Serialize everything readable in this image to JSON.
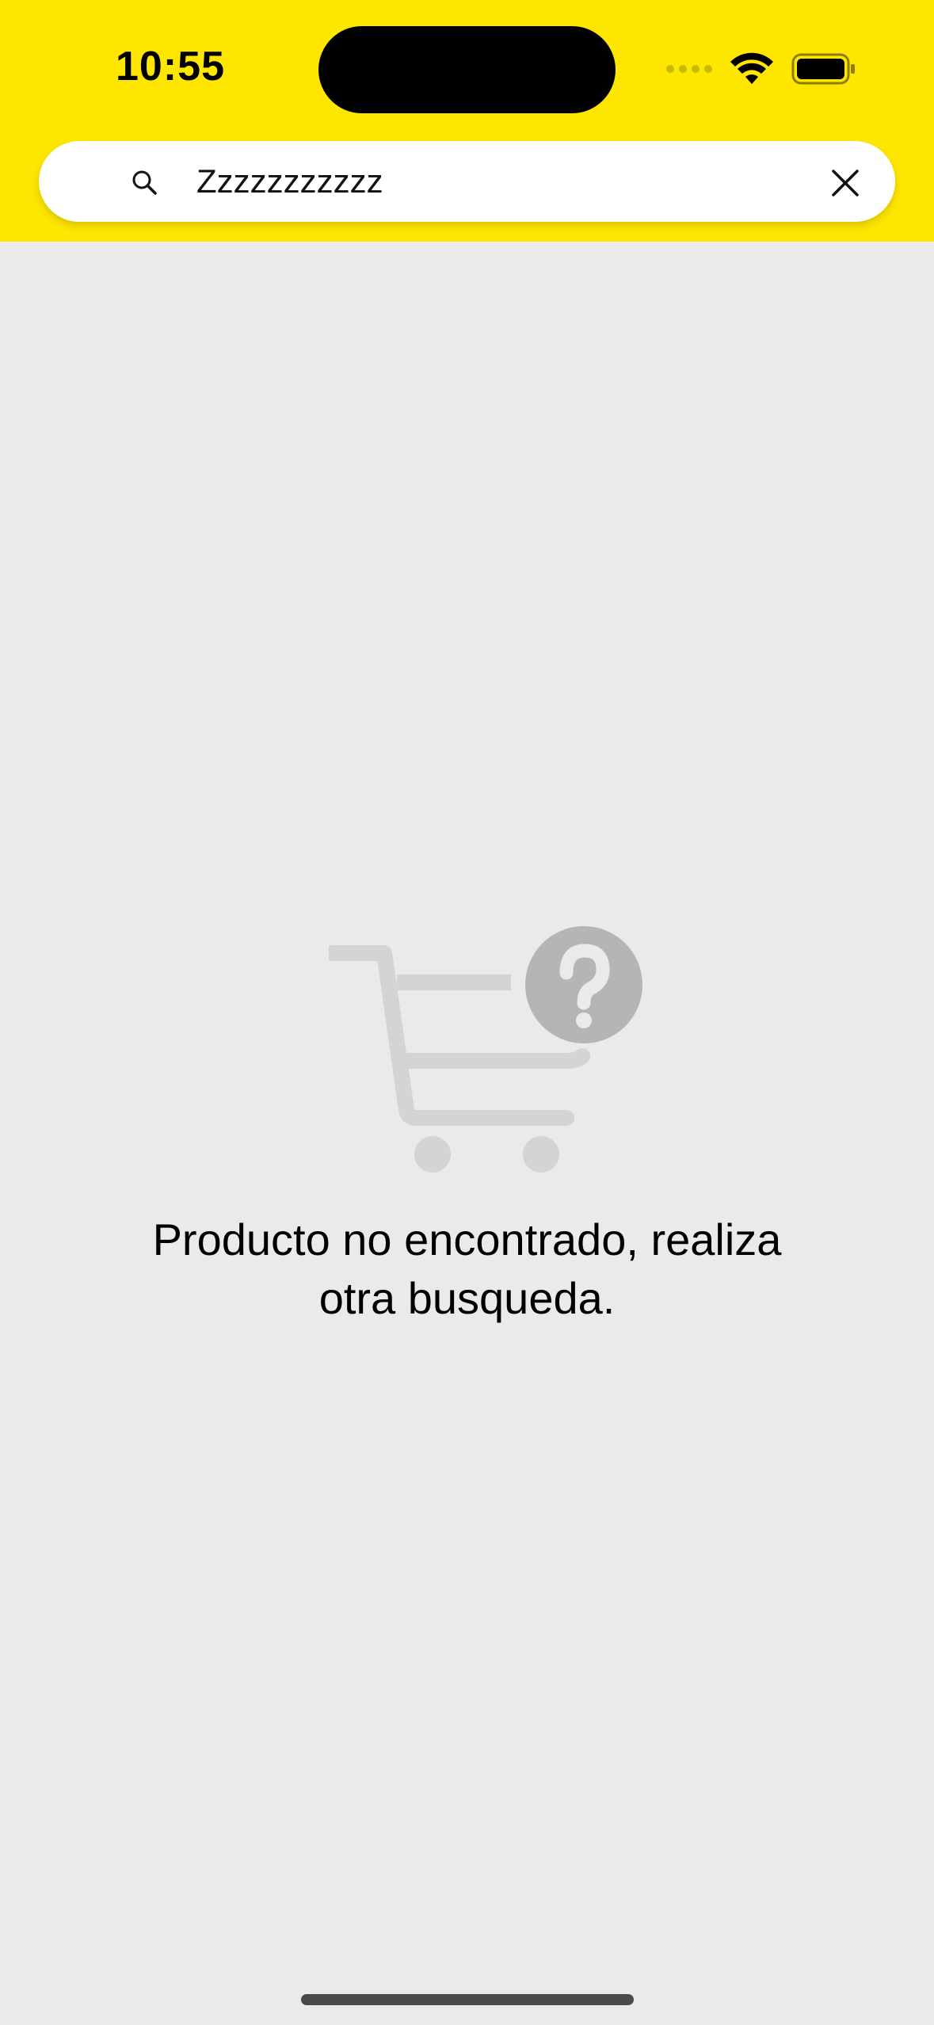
{
  "status_bar": {
    "time": "10:55"
  },
  "search": {
    "value": "Zzzzzzzzzzz",
    "icon": "search-icon",
    "clear_icon": "close-icon"
  },
  "empty_state": {
    "illustration": "cart-question-icon",
    "message_line1": "Producto no encontrado, realiza",
    "message_line2": "otra busqueda."
  },
  "colors": {
    "header_bg": "#FFE600",
    "page_bg": "#EAEAEA",
    "illustration": "#D4D4D4",
    "question_badge": "#B5B5B7"
  }
}
